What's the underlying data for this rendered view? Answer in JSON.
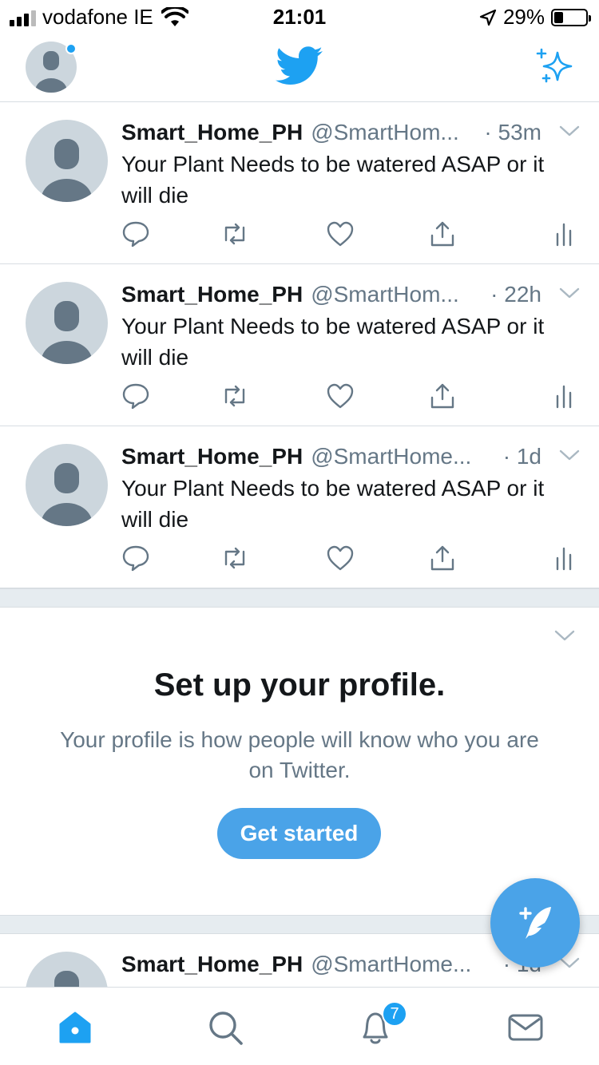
{
  "status_bar": {
    "carrier": "vodafone IE",
    "time": "21:01",
    "battery_percent": "29%",
    "battery_level": 0.29,
    "signal_bars_active": 3,
    "signal_bars_total": 4
  },
  "header": {
    "logo_icon": "twitter-bird-icon",
    "right_icon": "sparkle-icon",
    "accent_color": "#1da1f2"
  },
  "tweets": [
    {
      "name": "Smart_Home_PH",
      "handle": "@SmartHom...",
      "time": "· 53m",
      "text": "Your Plant Needs to be watered  ASAP or it will die"
    },
    {
      "name": "Smart_Home_PH",
      "handle": "@SmartHom...",
      "time": "· 22h",
      "text": "Your Plant Needs to be watered  ASAP or it will die"
    },
    {
      "name": "Smart_Home_PH",
      "handle": "@SmartHome...",
      "time": "· 1d",
      "text": "Your Plant Needs to be watered  ASAP or it will die"
    },
    {
      "name": "Smart_Home_PH",
      "handle": "@SmartHome...",
      "time": "· 1d",
      "text": ""
    }
  ],
  "setup_profile": {
    "title": "Set up your profile.",
    "description": "Your profile is how people will know who you are on Twitter.",
    "button_label": "Get started"
  },
  "tab_bar": {
    "items": [
      "home-icon",
      "search-icon",
      "notifications-icon",
      "messages-icon"
    ],
    "notification_count": "7"
  }
}
